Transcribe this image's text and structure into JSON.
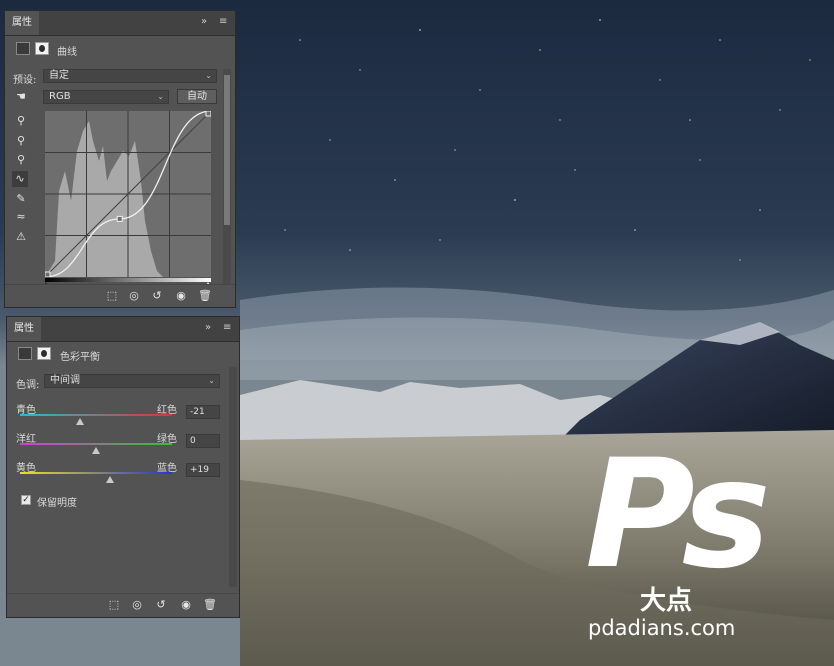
{
  "curves_panel": {
    "tab_title": "属性",
    "expand": "»",
    "menu": "≡",
    "adj_title": "曲线",
    "preset_label": "预设:",
    "preset_value": "自定",
    "channel_value": "RGB",
    "auto_label": "自动",
    "curve_points": [
      [
        0,
        0
      ],
      [
        0.45,
        0.35
      ],
      [
        1,
        1
      ]
    ]
  },
  "color_balance_panel": {
    "tab_title": "属性",
    "expand": "»",
    "menu": "≡",
    "adj_title": "色彩平衡",
    "tone_label": "色调:",
    "tone_value": "中间调",
    "sliders": [
      {
        "left": "青色",
        "right": "红色",
        "value": "-21",
        "level": -21
      },
      {
        "left": "洋红",
        "right": "绿色",
        "value": "0",
        "level": 0
      },
      {
        "left": "黄色",
        "right": "蓝色",
        "value": "+19",
        "level": 19
      }
    ],
    "preserve_label": "保留明度",
    "preserve_checked": "✓"
  },
  "watermark": {
    "logo_text": "Ps",
    "logo_sub": "大点",
    "url": "pdadians.com"
  },
  "colors": {
    "panel_bg": "#535353",
    "tab_bar": "#424242",
    "histogram": "#a9a9a9"
  }
}
